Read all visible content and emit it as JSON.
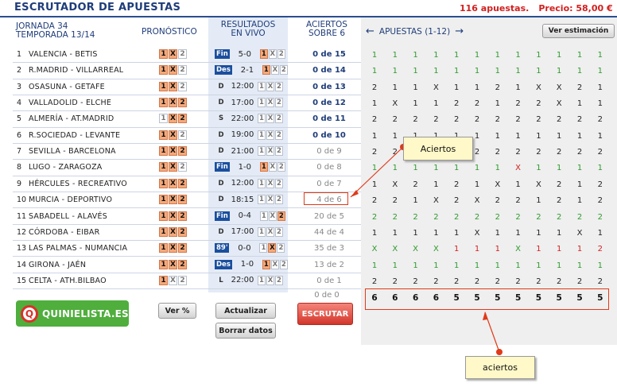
{
  "title": "ESCRUTADOR DE APUESTAS",
  "top_info": {
    "apuestas": "116 apuestas.",
    "precio": "Precio: 58,00 €"
  },
  "headers": {
    "jornada": "JORNADA 34",
    "temporada": "TEMPORADA 13/14",
    "pronostico": "PRONÓSTICO",
    "resultados_1": "RESULTADOS",
    "resultados_2": "EN VIVO",
    "aciertos_1": "ACIERTOS",
    "aciertos_2": "SOBRE 6",
    "apuestas_nav": "APUESTAS (1-12)",
    "ver_estimacion": "Ver estimación"
  },
  "matches": [
    {
      "num": "1",
      "name": "VALENCIA - BETIS",
      "pron": [
        1,
        1,
        0
      ],
      "status": "Fin",
      "status_blue": true,
      "score": "5-0",
      "res": [
        1,
        0,
        0
      ],
      "aciertos": "0 de 15",
      "ac_bold": true
    },
    {
      "num": "2",
      "name": "R.MADRID - VILLARREAL",
      "pron": [
        1,
        1,
        0
      ],
      "status": "Des",
      "status_blue": true,
      "score": "2-1",
      "res": [
        1,
        0,
        0
      ],
      "aciertos": "0 de 14",
      "ac_bold": true
    },
    {
      "num": "3",
      "name": "OSASUNA - GETAFE",
      "pron": [
        1,
        1,
        0
      ],
      "status": "D",
      "status_blue": false,
      "score": "12:00",
      "res": [
        0,
        0,
        0
      ],
      "aciertos": "0 de 13",
      "ac_bold": true
    },
    {
      "num": "4",
      "name": "VALLADOLID - ELCHE",
      "pron": [
        1,
        1,
        1
      ],
      "status": "D",
      "status_blue": false,
      "score": "17:00",
      "res": [
        0,
        0,
        0
      ],
      "aciertos": "0 de 12",
      "ac_bold": true
    },
    {
      "num": "5",
      "name": "ALMERÍA - AT.MADRID",
      "pron": [
        0,
        1,
        1
      ],
      "status": "S",
      "status_blue": false,
      "score": "22:00",
      "res": [
        0,
        0,
        0
      ],
      "aciertos": "0 de 11",
      "ac_bold": true
    },
    {
      "num": "6",
      "name": "R.SOCIEDAD - LEVANTE",
      "pron": [
        1,
        1,
        0
      ],
      "status": "D",
      "status_blue": false,
      "score": "19:00",
      "res": [
        0,
        0,
        0
      ],
      "aciertos": "0 de 10",
      "ac_bold": true
    },
    {
      "num": "7",
      "name": "SEVILLA - BARCELONA",
      "pron": [
        1,
        1,
        1
      ],
      "status": "D",
      "status_blue": false,
      "score": "21:00",
      "res": [
        0,
        0,
        0
      ],
      "aciertos": "0 de 9",
      "ac_bold": false
    },
    {
      "num": "8",
      "name": "LUGO - ZARAGOZA",
      "pron": [
        1,
        1,
        0
      ],
      "status": "Fin",
      "status_blue": true,
      "score": "1-0",
      "res": [
        1,
        0,
        0
      ],
      "aciertos": "0 de 8",
      "ac_bold": false
    },
    {
      "num": "9",
      "name": "HÉRCULES - RECREATIVO",
      "pron": [
        1,
        1,
        1
      ],
      "status": "D",
      "status_blue": false,
      "score": "12:00",
      "res": [
        0,
        0,
        0
      ],
      "aciertos": "0 de 7",
      "ac_bold": false
    },
    {
      "num": "10",
      "name": "MURCIA - DEPORTIVO",
      "pron": [
        1,
        1,
        1
      ],
      "status": "D",
      "status_blue": false,
      "score": "18:15",
      "res": [
        0,
        0,
        0
      ],
      "aciertos": "4 de 6",
      "ac_bold": false
    },
    {
      "num": "11",
      "name": "SABADELL - ALAVÉS",
      "pron": [
        1,
        1,
        1
      ],
      "status": "Fin",
      "status_blue": true,
      "score": "0-4",
      "res": [
        0,
        0,
        1
      ],
      "aciertos": "20 de 5",
      "ac_bold": false
    },
    {
      "num": "12",
      "name": "CÓRDOBA - EIBAR",
      "pron": [
        1,
        1,
        1
      ],
      "status": "D",
      "status_blue": false,
      "score": "17:00",
      "res": [
        0,
        0,
        0
      ],
      "aciertos": "44 de 4",
      "ac_bold": false
    },
    {
      "num": "13",
      "name": "LAS PALMAS - NUMANCIA",
      "pron": [
        1,
        1,
        1
      ],
      "status": "89'",
      "status_blue": true,
      "score": "0-0",
      "res": [
        0,
        1,
        0
      ],
      "aciertos": "35 de 3",
      "ac_bold": false
    },
    {
      "num": "14",
      "name": "GIRONA - JAÉN",
      "pron": [
        1,
        1,
        1
      ],
      "status": "Des",
      "status_blue": true,
      "score": "1-0",
      "res": [
        1,
        0,
        0
      ],
      "aciertos": "13 de 2",
      "ac_bold": false
    },
    {
      "num": "15",
      "name": "CELTA - ATH.BILBAO",
      "pron": [
        1,
        0,
        0
      ],
      "status": "L",
      "status_blue": false,
      "score": "22:00",
      "res": [
        0,
        0,
        0
      ],
      "aciertos": "0 de 1",
      "ac_bold": false
    }
  ],
  "aciertos_zero": "0 de 0",
  "grid": [
    [
      [
        "1",
        "g"
      ],
      [
        "1",
        "g"
      ],
      [
        "1",
        "g"
      ],
      [
        "1",
        "g"
      ],
      [
        "1",
        "g"
      ],
      [
        "1",
        "g"
      ],
      [
        "1",
        "g"
      ],
      [
        "1",
        "g"
      ],
      [
        "1",
        "g"
      ],
      [
        "1",
        "g"
      ],
      [
        "1",
        "g"
      ],
      [
        "1",
        "g"
      ]
    ],
    [
      [
        "1",
        "g"
      ],
      [
        "1",
        "g"
      ],
      [
        "1",
        "g"
      ],
      [
        "1",
        "g"
      ],
      [
        "1",
        "g"
      ],
      [
        "1",
        "g"
      ],
      [
        "1",
        "g"
      ],
      [
        "1",
        "g"
      ],
      [
        "1",
        "g"
      ],
      [
        "1",
        "g"
      ],
      [
        "1",
        "g"
      ],
      [
        "1",
        "g"
      ]
    ],
    [
      [
        "2",
        "k"
      ],
      [
        "1",
        "k"
      ],
      [
        "1",
        "k"
      ],
      [
        "X",
        "k"
      ],
      [
        "1",
        "k"
      ],
      [
        "1",
        "k"
      ],
      [
        "2",
        "k"
      ],
      [
        "1",
        "k"
      ],
      [
        "X",
        "k"
      ],
      [
        "X",
        "k"
      ],
      [
        "2",
        "k"
      ],
      [
        "1",
        "k"
      ]
    ],
    [
      [
        "1",
        "k"
      ],
      [
        "X",
        "k"
      ],
      [
        "1",
        "k"
      ],
      [
        "1",
        "k"
      ],
      [
        "2",
        "k"
      ],
      [
        "2",
        "k"
      ],
      [
        "1",
        "k"
      ],
      [
        "2",
        "k"
      ],
      [
        "2",
        "k"
      ],
      [
        "X",
        "k"
      ],
      [
        "1",
        "k"
      ],
      [
        "1",
        "k"
      ]
    ],
    [
      [
        "2",
        "k"
      ],
      [
        "2",
        "k"
      ],
      [
        "2",
        "k"
      ],
      [
        "2",
        "k"
      ],
      [
        "2",
        "k"
      ],
      [
        "2",
        "k"
      ],
      [
        "2",
        "k"
      ],
      [
        "2",
        "k"
      ],
      [
        "2",
        "k"
      ],
      [
        "2",
        "k"
      ],
      [
        "2",
        "k"
      ],
      [
        "2",
        "k"
      ]
    ],
    [
      [
        "1",
        "k"
      ],
      [
        "1",
        "k"
      ],
      [
        "1",
        "k"
      ],
      [
        "1",
        "k"
      ],
      [
        "1",
        "k"
      ],
      [
        "1",
        "k"
      ],
      [
        "1",
        "k"
      ],
      [
        "1",
        "k"
      ],
      [
        "1",
        "k"
      ],
      [
        "1",
        "k"
      ],
      [
        "1",
        "k"
      ],
      [
        "1",
        "k"
      ]
    ],
    [
      [
        "2",
        "k"
      ],
      [
        "2",
        "k"
      ],
      [
        "2",
        "k"
      ],
      [
        "2",
        "k"
      ],
      [
        "2",
        "k"
      ],
      [
        "2",
        "k"
      ],
      [
        "2",
        "k"
      ],
      [
        "2",
        "k"
      ],
      [
        "2",
        "k"
      ],
      [
        "2",
        "k"
      ],
      [
        "2",
        "k"
      ],
      [
        "2",
        "k"
      ]
    ],
    [
      [
        "1",
        "g"
      ],
      [
        "1",
        "g"
      ],
      [
        "1",
        "g"
      ],
      [
        "1",
        "g"
      ],
      [
        "1",
        "g"
      ],
      [
        "1",
        "g"
      ],
      [
        "1",
        "g"
      ],
      [
        "X",
        "r"
      ],
      [
        "1",
        "g"
      ],
      [
        "1",
        "g"
      ],
      [
        "1",
        "g"
      ],
      [
        "1",
        "g"
      ]
    ],
    [
      [
        "1",
        "k"
      ],
      [
        "X",
        "k"
      ],
      [
        "2",
        "k"
      ],
      [
        "1",
        "k"
      ],
      [
        "2",
        "k"
      ],
      [
        "1",
        "k"
      ],
      [
        "X",
        "k"
      ],
      [
        "1",
        "k"
      ],
      [
        "X",
        "k"
      ],
      [
        "2",
        "k"
      ],
      [
        "1",
        "k"
      ],
      [
        "2",
        "k"
      ]
    ],
    [
      [
        "2",
        "k"
      ],
      [
        "2",
        "k"
      ],
      [
        "1",
        "k"
      ],
      [
        "X",
        "k"
      ],
      [
        "2",
        "k"
      ],
      [
        "X",
        "k"
      ],
      [
        "2",
        "k"
      ],
      [
        "2",
        "k"
      ],
      [
        "1",
        "k"
      ],
      [
        "2",
        "k"
      ],
      [
        "1",
        "k"
      ],
      [
        "2",
        "k"
      ]
    ],
    [
      [
        "2",
        "g"
      ],
      [
        "2",
        "g"
      ],
      [
        "2",
        "g"
      ],
      [
        "2",
        "g"
      ],
      [
        "2",
        "g"
      ],
      [
        "2",
        "g"
      ],
      [
        "2",
        "g"
      ],
      [
        "2",
        "g"
      ],
      [
        "2",
        "g"
      ],
      [
        "2",
        "g"
      ],
      [
        "2",
        "g"
      ],
      [
        "2",
        "g"
      ]
    ],
    [
      [
        "1",
        "k"
      ],
      [
        "1",
        "k"
      ],
      [
        "1",
        "k"
      ],
      [
        "1",
        "k"
      ],
      [
        "1",
        "k"
      ],
      [
        "X",
        "k"
      ],
      [
        "1",
        "k"
      ],
      [
        "1",
        "k"
      ],
      [
        "1",
        "k"
      ],
      [
        "1",
        "k"
      ],
      [
        "X",
        "k"
      ],
      [
        "1",
        "k"
      ]
    ],
    [
      [
        "X",
        "g"
      ],
      [
        "X",
        "g"
      ],
      [
        "X",
        "g"
      ],
      [
        "X",
        "g"
      ],
      [
        "1",
        "r"
      ],
      [
        "1",
        "r"
      ],
      [
        "1",
        "r"
      ],
      [
        "X",
        "g"
      ],
      [
        "1",
        "r"
      ],
      [
        "1",
        "r"
      ],
      [
        "1",
        "r"
      ],
      [
        "2",
        "r"
      ]
    ],
    [
      [
        "1",
        "g"
      ],
      [
        "1",
        "g"
      ],
      [
        "1",
        "g"
      ],
      [
        "1",
        "g"
      ],
      [
        "1",
        "g"
      ],
      [
        "1",
        "g"
      ],
      [
        "1",
        "g"
      ],
      [
        "1",
        "g"
      ],
      [
        "1",
        "g"
      ],
      [
        "1",
        "g"
      ],
      [
        "1",
        "g"
      ],
      [
        "1",
        "g"
      ]
    ],
    [
      [
        "2",
        "k"
      ],
      [
        "2",
        "k"
      ],
      [
        "2",
        "k"
      ],
      [
        "2",
        "k"
      ],
      [
        "2",
        "k"
      ],
      [
        "2",
        "k"
      ],
      [
        "2",
        "k"
      ],
      [
        "2",
        "k"
      ],
      [
        "2",
        "k"
      ],
      [
        "2",
        "k"
      ],
      [
        "2",
        "k"
      ],
      [
        "2",
        "k"
      ]
    ]
  ],
  "totals": [
    "6",
    "6",
    "6",
    "6",
    "5",
    "5",
    "5",
    "5",
    "5",
    "5",
    "5",
    "5"
  ],
  "buttons": {
    "ver_pct": "Ver %",
    "actualizar": "Actualizar",
    "borrar": "Borrar datos",
    "escrutar": "ESCRUTAR"
  },
  "logo_text": "QUINIELISTA.ES",
  "annotations": {
    "callout_top": "Aciertos",
    "callout_bottom": "aciertos"
  },
  "symbols": [
    "1",
    "X",
    "2"
  ],
  "colors": {
    "accent": "#1f3d7a",
    "highlight": "#f5a97a",
    "annotation": "#e03a1a",
    "green": "#2e9b2e",
    "red": "#d21f1f"
  }
}
